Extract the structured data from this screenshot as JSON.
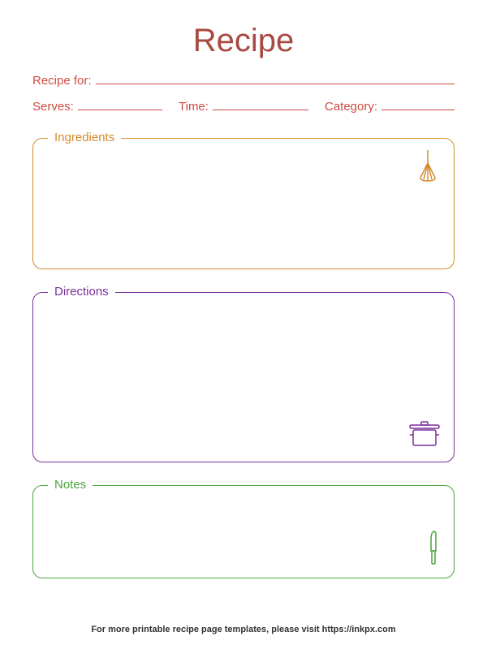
{
  "title": "Recipe",
  "header": {
    "recipe_for_label": "Recipe for:",
    "serves_label": "Serves:",
    "time_label": "Time:",
    "category_label": "Category:"
  },
  "sections": {
    "ingredients_label": "Ingredients",
    "directions_label": "Directions",
    "notes_label": "Notes"
  },
  "footer": "For more printable recipe page templates, please visit https://inkpx.com",
  "colors": {
    "title": "#a74a42",
    "header": "#d14a42",
    "ingredients": "#d38a2a",
    "directions": "#7a2d9c",
    "notes": "#4aa43a"
  }
}
